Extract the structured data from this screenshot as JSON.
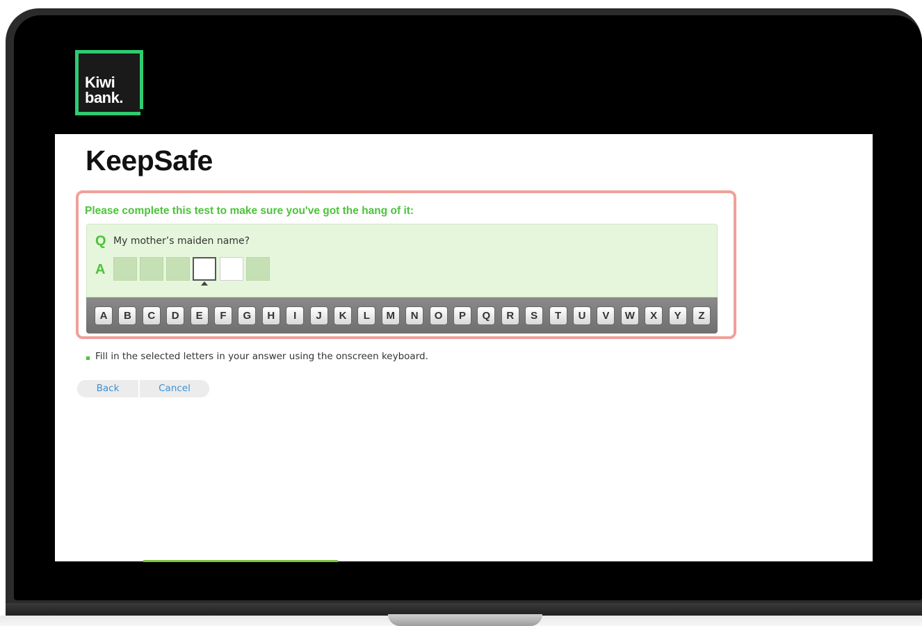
{
  "brand": {
    "logo_line1": "Kiwi",
    "logo_line2": "bank."
  },
  "page": {
    "title": "KeepSafe"
  },
  "test": {
    "instruction": "Please complete this test to make sure you've got the hang of it:",
    "question_marker": "Q",
    "question": "My mother’s maiden name?",
    "answer_marker": "A",
    "answer_slots": [
      "filled",
      "filled",
      "filled",
      "selected",
      "open",
      "filled"
    ]
  },
  "keyboard": {
    "keys": [
      "A",
      "B",
      "C",
      "D",
      "E",
      "F",
      "G",
      "H",
      "I",
      "J",
      "K",
      "L",
      "M",
      "N",
      "O",
      "P",
      "Q",
      "R",
      "S",
      "T",
      "U",
      "V",
      "W",
      "X",
      "Y",
      "Z"
    ]
  },
  "hint": "Fill in the selected letters in your answer using the onscreen keyboard.",
  "actions": {
    "back": "Back",
    "cancel": "Cancel"
  },
  "colors": {
    "accent_green": "#4cc33b",
    "brand_green": "#2ecc71",
    "highlight_border": "#f0a09a",
    "link_blue": "#3d8fd1"
  }
}
